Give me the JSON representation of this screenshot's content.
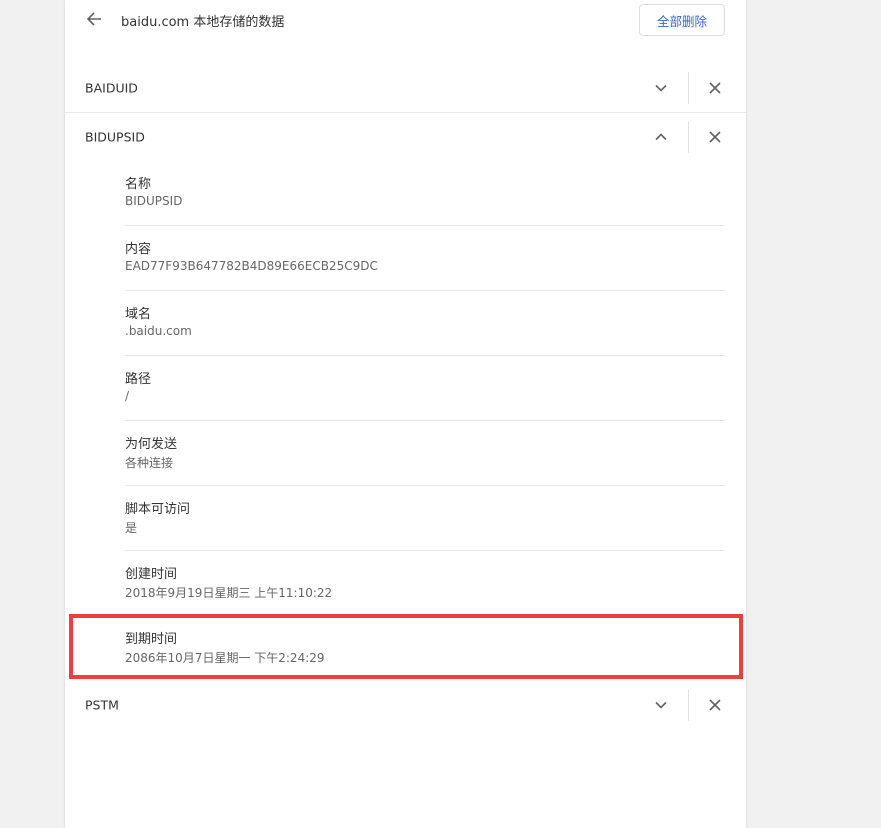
{
  "header": {
    "title": "baidu.com 本地存储的数据",
    "delete_all_label": "全部删除",
    "back_icon": "arrow-left-icon"
  },
  "cookies": [
    {
      "name": "BAIDUID",
      "expanded": false
    },
    {
      "name": "BIDUPSID",
      "expanded": true
    },
    {
      "name": "PSTM",
      "expanded": false
    }
  ],
  "details": [
    {
      "label": "名称",
      "value": "BIDUPSID"
    },
    {
      "label": "内容",
      "value": "EAD77F93B647782B4D89E66ECB25C9DC"
    },
    {
      "label": "域名",
      "value": ".baidu.com"
    },
    {
      "label": "路径",
      "value": "/"
    },
    {
      "label": "为何发送",
      "value": "各种连接"
    },
    {
      "label": "脚本可访问",
      "value": "是"
    },
    {
      "label": "创建时间",
      "value": "2018年9月19日星期三 上午11:10:22"
    },
    {
      "label": "到期时间",
      "value": "2086年10月7日星期一 下午2:24:29"
    }
  ],
  "colors": {
    "accent": "#3367d6",
    "highlight": "#ef3e3e",
    "background": "#f1f1f1"
  }
}
